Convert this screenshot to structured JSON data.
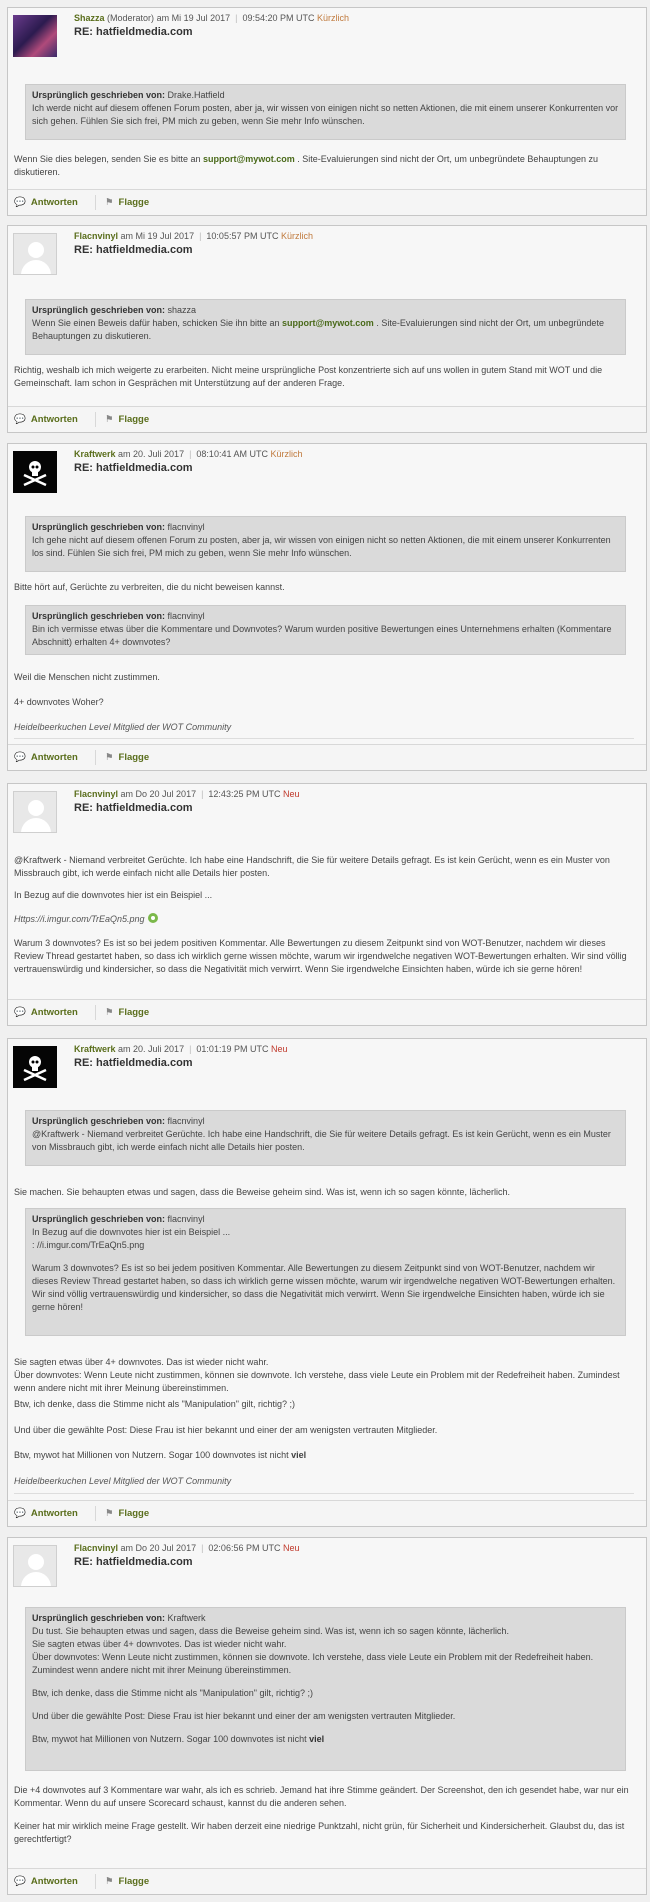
{
  "labels": {
    "orig_prefix": "Ursprünglich geschrieben von:",
    "reply": "Antworten",
    "flag": "Flagge"
  },
  "posts": [
    {
      "user": "Shazza",
      "role": "(Moderator)",
      "date": "am Mi 19 Jul 2017",
      "time": "09:54:20 PM UTC",
      "status": "Kürzlich",
      "title": "RE: hatfieldmedia.com",
      "quote_author": "Drake.Hatfield",
      "quote_text": "Ich werde nicht auf diesem offenen Forum posten, aber ja, wir wissen von einigen nicht so netten Aktionen, die mit einem unserer Konkurrenten vor sich gehen. Fühlen Sie sich frei, PM mich zu geben, wenn Sie mehr Info wünschen.",
      "p1a": "Wenn Sie dies belegen, senden Sie es bitte an",
      "p1mail": "support@mywot.com",
      "p1b": ". Site-Evaluierungen sind nicht der Ort, um unbegründete Behauptungen zu diskutieren."
    },
    {
      "user": "Flacnvinyl",
      "date": "am Mi 19 Jul 2017",
      "time": "10:05:57 PM UTC",
      "status": "Kürzlich",
      "title": "RE: hatfieldmedia.com",
      "quote_author": "shazza",
      "quote_a": "Wenn Sie einen Beweis dafür haben, schicken Sie ihn bitte an",
      "quote_mail": "support@mywot.com",
      "quote_b": ". Site-Evaluierungen sind nicht der Ort, um unbegründete Behauptungen zu diskutieren.",
      "p1": "Richtig, weshalb ich mich weigerte zu erarbeiten. Nicht meine ursprüngliche Post konzentrierte sich auf uns wollen in gutem Stand mit WOT und die Gemeinschaft. Iam schon in Gesprächen mit Unterstützung auf der anderen Frage."
    },
    {
      "user": "Kraftwerk",
      "date": "am 20. Juli 2017",
      "time": "08:10:41 AM UTC",
      "status": "Kürzlich",
      "title": "RE: hatfieldmedia.com",
      "q1_author": "flacnvinyl",
      "q1_text": "Ich gehe nicht auf diesem offenen Forum zu posten, aber ja, wir wissen von einigen nicht so netten Aktionen, die mit einem unserer Konkurrenten los sind. Fühlen Sie sich frei, PM mich zu geben, wenn Sie mehr Info wünschen.",
      "p1": "Bitte hört auf, Gerüchte zu verbreiten, die du nicht beweisen kannst.",
      "q2_author": "flacnvinyl",
      "q2_text": "Bin ich vermisse etwas über die Kommentare und Downvotes? Warum wurden positive Bewertungen eines Unternehmens erhalten (Kommentare Abschnitt) erhalten 4+ downvotes?",
      "p2": "Weil die Menschen nicht zustimmen.",
      "p3": "4+ downvotes Woher?",
      "sig": "Heidelbeerkuchen Level Mitglied der WOT Community"
    },
    {
      "user": "Flacnvinyl",
      "date": "am Do 20 Jul 2017",
      "time": "12:43:25 PM UTC",
      "status": "Neu",
      "title": "RE: hatfieldmedia.com",
      "p1": "@Kraftwerk - Niemand verbreitet Gerüchte. Ich habe eine Handschrift, die Sie für weitere Details gefragt. Es ist kein Gerücht, wenn es ein Muster von Missbrauch gibt, ich werde einfach nicht alle Details hier posten.",
      "p2": "In Bezug auf die downvotes hier ist ein Beispiel ...",
      "link": "Https://i.imgur.com/TrEaQn5.png",
      "p3": "Warum 3 downvotes? Es ist so bei jedem positiven Kommentar. Alle Bewertungen zu diesem Zeitpunkt sind von WOT-Benutzer, nachdem wir dieses Review Thread gestartet haben, so dass ich wirklich gerne wissen möchte, warum wir irgendwelche negativen WOT-Bewertungen erhalten. Wir sind völlig vertrauenswürdig und kindersicher, so dass die Negativität mich verwirrt. Wenn Sie irgendwelche Einsichten haben, würde ich sie gerne hören!"
    },
    {
      "user": "Kraftwerk",
      "date": "am 20. Juli 2017",
      "time": "01:01:19 PM UTC",
      "status": "Neu",
      "title": "RE: hatfieldmedia.com",
      "q1_author": "flacnvinyl",
      "q1_text": "@Kraftwerk - Niemand verbreitet Gerüchte. Ich habe eine Handschrift, die Sie für weitere Details gefragt. Es ist kein Gerücht, wenn es ein Muster von Missbrauch gibt, ich werde einfach nicht alle Details hier posten.",
      "p1": "Sie machen. Sie behaupten etwas und sagen, dass die Beweise geheim sind. Was ist, wenn ich so sagen könnte, lächerlich.",
      "q2_author": "flacnvinyl",
      "q2_l1": "In Bezug auf die downvotes hier ist ein Beispiel ...",
      "q2_l2": ": //i.imgur.com/TrEaQn5.png",
      "q2_l3": "Warum 3 downvotes? Es ist so bei jedem positiven Kommentar. Alle Bewertungen zu diesem Zeitpunkt sind von WOT-Benutzer, nachdem wir dieses Review Thread gestartet haben, so dass ich wirklich gerne wissen möchte, warum wir irgendwelche negativen WOT-Bewertungen erhalten. Wir sind völlig vertrauenswürdig und kindersicher, so dass die Negativität mich verwirrt. Wenn Sie irgendwelche Einsichten haben, würde ich sie gerne hören!",
      "p2": "Sie sagten etwas über 4+ downvotes. Das ist wieder nicht wahr.",
      "p3": "Über downvotes: Wenn Leute nicht zustimmen, können sie downvote. Ich verstehe, dass viele Leute ein Problem mit der Redefreiheit haben. Zumindest wenn andere nicht mit ihrer Meinung übereinstimmen.",
      "p4": "Btw, ich denke, dass die Stimme nicht als \"Manipulation\" gilt, richtig? ;)",
      "p5": "Und über die gewählte Post: Diese Frau ist hier bekannt und einer der am wenigsten vertrauten Mitglieder.",
      "p6a": "Btw, mywot hat Millionen von Nutzern. Sogar 100 downvotes ist nicht",
      "p6b": "viel",
      "sig": "Heidelbeerkuchen Level Mitglied der WOT Community"
    },
    {
      "user": "Flacnvinyl",
      "date": "am Do 20 Jul 2017",
      "time": "02:06:56 PM UTC",
      "status": "Neu",
      "title": "RE: hatfieldmedia.com",
      "q_author": "Kraftwerk",
      "q_l1": "Du tust. Sie behaupten etwas und sagen, dass die Beweise geheim sind. Was ist, wenn ich so sagen könnte, lächerlich.",
      "q_l2": "Sie sagten etwas über 4+ downvotes. Das ist wieder nicht wahr.",
      "q_l3": "Über downvotes: Wenn Leute nicht zustimmen, können sie downvote. Ich verstehe, dass viele Leute ein Problem mit der Redefreiheit haben. Zumindest wenn andere nicht mit ihrer Meinung übereinstimmen.",
      "q_l4": "Btw, ich denke, dass die Stimme nicht als \"Manipulation\" gilt, richtig? ;)",
      "q_l5": "Und über die gewählte Post: Diese Frau ist hier bekannt und einer der am wenigsten vertrauten Mitglieder.",
      "q_l6a": "Btw, mywot hat Millionen von Nutzern. Sogar 100 downvotes ist nicht",
      "q_l6b": "viel",
      "p1": "Die +4 downvotes auf 3 Kommentare war wahr, als ich es schrieb. Jemand hat ihre Stimme geändert. Der Screenshot, den ich gesendet habe, war nur ein Kommentar. Wenn du auf unsere Scorecard schaust, kannst du die anderen sehen.",
      "p2": "Keiner hat mir wirklich meine Frage gestellt. Wir haben derzeit eine niedrige Punktzahl, nicht grün, für Sicherheit und Kindersicherheit. Glaubst du, das ist gerechtfertigt?"
    }
  ]
}
